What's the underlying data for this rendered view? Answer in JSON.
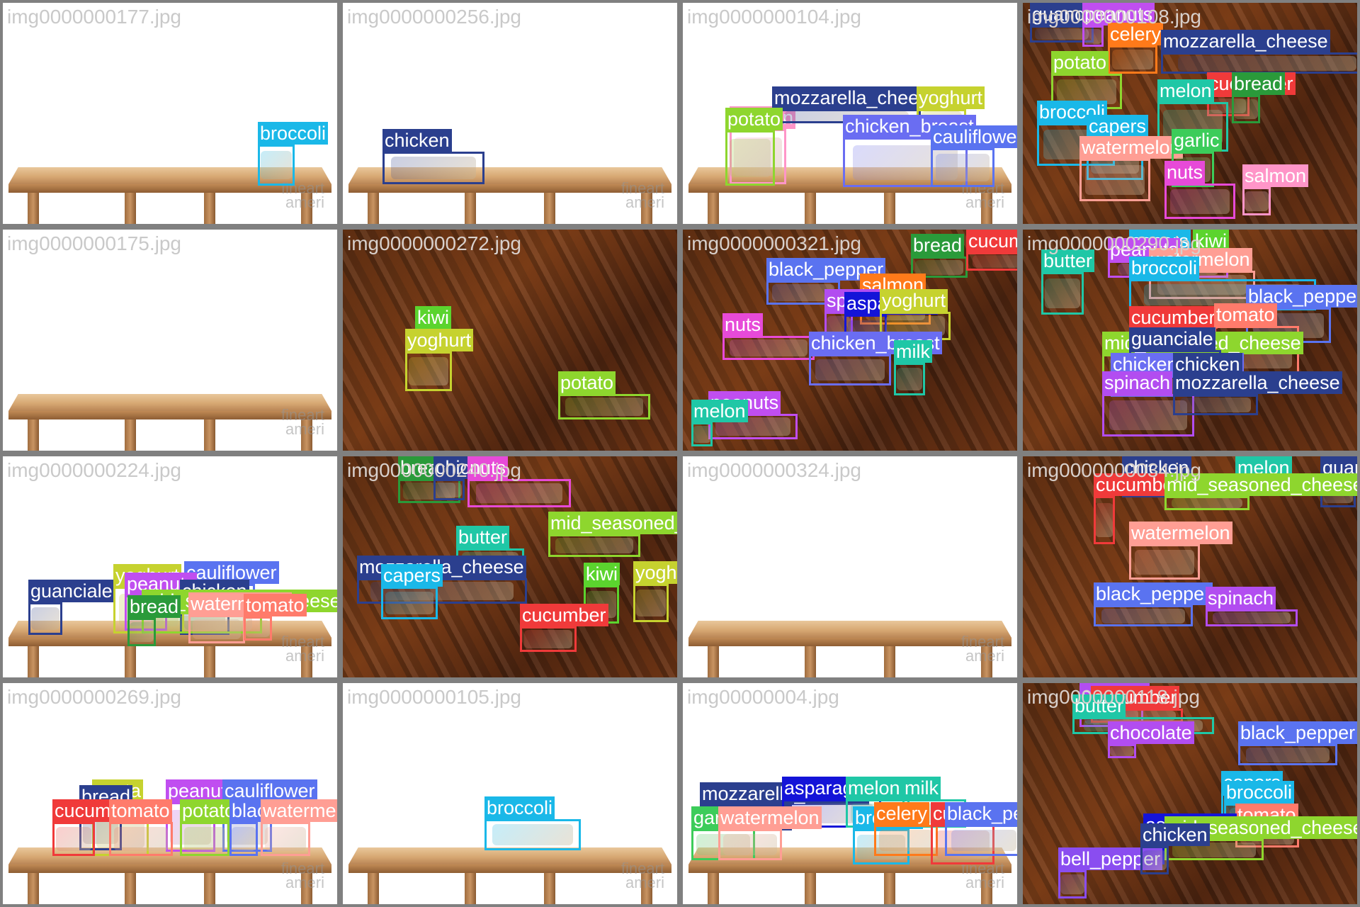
{
  "tiles": [
    {
      "filename": "img0000000177.jpg",
      "background": "white",
      "table": true,
      "detections": [
        {
          "label": "broccoli",
          "color": "#1ab8e8"
        }
      ]
    },
    {
      "filename": "img0000000256.jpg",
      "background": "white",
      "table": true,
      "detections": [
        {
          "label": "chicken",
          "color": "#2b3f8e"
        }
      ]
    },
    {
      "filename": "img0000000104.jpg",
      "background": "white",
      "table": true,
      "detections": [
        {
          "label": "salmon",
          "color": "#ff95c8"
        },
        {
          "label": "mozzarella_cheese",
          "color": "#2b3f8e"
        },
        {
          "label": "yoghurt",
          "color": "#c6d22f"
        },
        {
          "label": "potato",
          "color": "#8ed62e"
        },
        {
          "label": "chicken_breast",
          "color": "#6a6df2"
        },
        {
          "label": "cauliflower",
          "color": "#5a73f0"
        }
      ]
    },
    {
      "filename": "img0000000108.jpg",
      "background": "wood",
      "table": false,
      "detections": [
        {
          "label": "guanciale",
          "color": "#2b3f8e"
        },
        {
          "label": "peanuts",
          "color": "#c04ef0"
        },
        {
          "label": "celery",
          "color": "#ff7a1a"
        },
        {
          "label": "mozzarella_cheese",
          "color": "#2b3f8e"
        },
        {
          "label": "potato",
          "color": "#8ed62e"
        },
        {
          "label": "cucumber",
          "color": "#f03a3a"
        },
        {
          "label": "bread",
          "color": "#2a9a3a"
        },
        {
          "label": "broccoli",
          "color": "#1ab8e8"
        },
        {
          "label": "melon",
          "color": "#1fc7a6"
        },
        {
          "label": "capers",
          "color": "#1ab8e8"
        },
        {
          "label": "watermelon",
          "color": "#ff9e94"
        },
        {
          "label": "garlic",
          "color": "#3ccc5a"
        },
        {
          "label": "nuts",
          "color": "#e74ad8"
        },
        {
          "label": "salmon",
          "color": "#ff95c8"
        }
      ]
    },
    {
      "filename": "img0000000175.jpg",
      "background": "white",
      "table": true,
      "detections": []
    },
    {
      "filename": "img0000000272.jpg",
      "background": "wood",
      "table": false,
      "detections": [
        {
          "label": "kiwi",
          "color": "#5bd42e"
        },
        {
          "label": "yoghurt",
          "color": "#c6d22f"
        },
        {
          "label": "potato",
          "color": "#8ed62e"
        }
      ]
    },
    {
      "filename": "img0000000321.jpg",
      "background": "wood",
      "table": false,
      "detections": [
        {
          "label": "bread",
          "color": "#2a9a3a"
        },
        {
          "label": "cucumber",
          "color": "#f03a3a"
        },
        {
          "label": "black_pepper",
          "color": "#5a73f0"
        },
        {
          "label": "salmon",
          "color": "#ff7a1a"
        },
        {
          "label": "spinach",
          "color": "#b24df0"
        },
        {
          "label": "asparagus",
          "color": "#1414d8"
        },
        {
          "label": "yoghurt",
          "color": "#c6d22f"
        },
        {
          "label": "nuts",
          "color": "#e74ad8"
        },
        {
          "label": "chicken_breast",
          "color": "#6a6df2"
        },
        {
          "label": "milk",
          "color": "#1fc7a6"
        },
        {
          "label": "peanuts",
          "color": "#c04ef0"
        },
        {
          "label": "melon",
          "color": "#1fc7a6"
        }
      ]
    },
    {
      "filename": "img0000000290.jpg",
      "background": "wood",
      "table": false,
      "detections": [
        {
          "label": "kiwi",
          "color": "#5bd42e"
        },
        {
          "label": "capers",
          "color": "#1ab8e8"
        },
        {
          "label": "butter",
          "color": "#1fc7a6"
        },
        {
          "label": "peanuts",
          "color": "#c04ef0"
        },
        {
          "label": "watermelon",
          "color": "#ff9e94"
        },
        {
          "label": "broccoli",
          "color": "#1ab8e8"
        },
        {
          "label": "black_pepper",
          "color": "#5a73f0"
        },
        {
          "label": "cucumber",
          "color": "#f03a3a"
        },
        {
          "label": "tomato",
          "color": "#ff7b6b"
        },
        {
          "label": "mid_seasoned_cheese",
          "color": "#8ed62e"
        },
        {
          "label": "guanciale",
          "color": "#2b3f8e"
        },
        {
          "label": "chicken_breast",
          "color": "#6a6df2"
        },
        {
          "label": "chicken",
          "color": "#2b3f8e"
        },
        {
          "label": "spinach",
          "color": "#b24df0"
        },
        {
          "label": "mozzarella_cheese",
          "color": "#2b3f8e"
        }
      ]
    },
    {
      "filename": "img0000000224.jpg",
      "background": "white",
      "table": true,
      "detections": [
        {
          "label": "guanciale",
          "color": "#2b3f8e"
        },
        {
          "label": "yoghurt",
          "color": "#c6d22f"
        },
        {
          "label": "cauliflower",
          "color": "#5a73f0"
        },
        {
          "label": "peanuts",
          "color": "#c04ef0"
        },
        {
          "label": "chicken",
          "color": "#2b3f8e"
        },
        {
          "label": "mid_seasoned_cheese",
          "color": "#8ed62e"
        },
        {
          "label": "bread",
          "color": "#2a9a3a"
        },
        {
          "label": "watermelon",
          "color": "#ff9e94"
        },
        {
          "label": "tomato",
          "color": "#ff7b6b"
        }
      ]
    },
    {
      "filename": "img0000000240.jpg",
      "background": "wood",
      "table": false,
      "detections": [
        {
          "label": "bread",
          "color": "#2a9a3a"
        },
        {
          "label": "chicken",
          "color": "#2b3f8e"
        },
        {
          "label": "nuts",
          "color": "#e74ad8"
        },
        {
          "label": "mid_seasoned_cheese",
          "color": "#8ed62e"
        },
        {
          "label": "butter",
          "color": "#1fc7a6"
        },
        {
          "label": "mozzarella_cheese",
          "color": "#2b3f8e"
        },
        {
          "label": "kiwi",
          "color": "#5bd42e"
        },
        {
          "label": "yoghurt",
          "color": "#c6d22f"
        },
        {
          "label": "capers",
          "color": "#1ab8e8"
        },
        {
          "label": "cucumber",
          "color": "#f03a3a"
        }
      ]
    },
    {
      "filename": "img0000000324.jpg",
      "background": "white",
      "table": true,
      "detections": []
    },
    {
      "filename": "img0000000034.jpg",
      "background": "wood",
      "table": false,
      "detections": [
        {
          "label": "chicken",
          "color": "#2b3f8e"
        },
        {
          "label": "melon",
          "color": "#1fc7a6"
        },
        {
          "label": "guanciale",
          "color": "#2b3f8e"
        },
        {
          "label": "cucumber",
          "color": "#f03a3a"
        },
        {
          "label": "mid_seasoned_cheese",
          "color": "#8ed62e"
        },
        {
          "label": "watermelon",
          "color": "#ff9e94"
        },
        {
          "label": "black_pepper",
          "color": "#5a73f0"
        },
        {
          "label": "spinach",
          "color": "#b24df0"
        }
      ]
    },
    {
      "filename": "img0000000269.jpg",
      "background": "white",
      "table": true,
      "detections": [
        {
          "label": "pasta",
          "color": "#c6d22f"
        },
        {
          "label": "bread",
          "color": "#2b3f8e"
        },
        {
          "label": "peanuts",
          "color": "#c04ef0"
        },
        {
          "label": "cauliflower",
          "color": "#5a73f0"
        },
        {
          "label": "cucumber",
          "color": "#f03a3a"
        },
        {
          "label": "tomato",
          "color": "#ff7b6b"
        },
        {
          "label": "potato",
          "color": "#8ed62e"
        },
        {
          "label": "black_pepper",
          "color": "#5a73f0"
        },
        {
          "label": "watermelon",
          "color": "#ff9e94"
        }
      ]
    },
    {
      "filename": "img0000000105.jpg",
      "background": "white",
      "table": true,
      "detections": [
        {
          "label": "broccoli",
          "color": "#1ab8e8"
        }
      ]
    },
    {
      "filename": "img00000004.jpg",
      "background": "white",
      "table": true,
      "detections": [
        {
          "label": "mozzarella_cheese",
          "color": "#2b3f8e"
        },
        {
          "label": "asparagus",
          "color": "#1414d8"
        },
        {
          "label": "melon",
          "color": "#1fc7a6"
        },
        {
          "label": "milk",
          "color": "#1fc7a6"
        },
        {
          "label": "garlic",
          "color": "#3ccc5a"
        },
        {
          "label": "watermelon",
          "color": "#ff9e94"
        },
        {
          "label": "broccoli",
          "color": "#1ab8e8"
        },
        {
          "label": "celery",
          "color": "#ff7a1a"
        },
        {
          "label": "cucumber",
          "color": "#f03a3a"
        },
        {
          "label": "black_pepper",
          "color": "#5a73f0"
        }
      ]
    },
    {
      "filename": "img0000000118.jpg",
      "background": "wood",
      "table": false,
      "detections": [
        {
          "label": "spinach",
          "color": "#b24df0"
        },
        {
          "label": "cucumber",
          "color": "#f03a3a"
        },
        {
          "label": "butter",
          "color": "#1fc7a6"
        },
        {
          "label": "black_pepper",
          "color": "#5a73f0"
        },
        {
          "label": "chocolate",
          "color": "#b24df0"
        },
        {
          "label": "capers",
          "color": "#1ab8e8"
        },
        {
          "label": "broccoli",
          "color": "#1ab8e8"
        },
        {
          "label": "tomato",
          "color": "#ff7b6b"
        },
        {
          "label": "asparagus",
          "color": "#1414d8"
        },
        {
          "label": "mid_seasoned_cheese",
          "color": "#8ed62e"
        },
        {
          "label": "bell_pepper",
          "color": "#8a4df0"
        },
        {
          "label": "chicken",
          "color": "#2b3f8e"
        }
      ]
    }
  ],
  "watermark": "fineart\nameri"
}
